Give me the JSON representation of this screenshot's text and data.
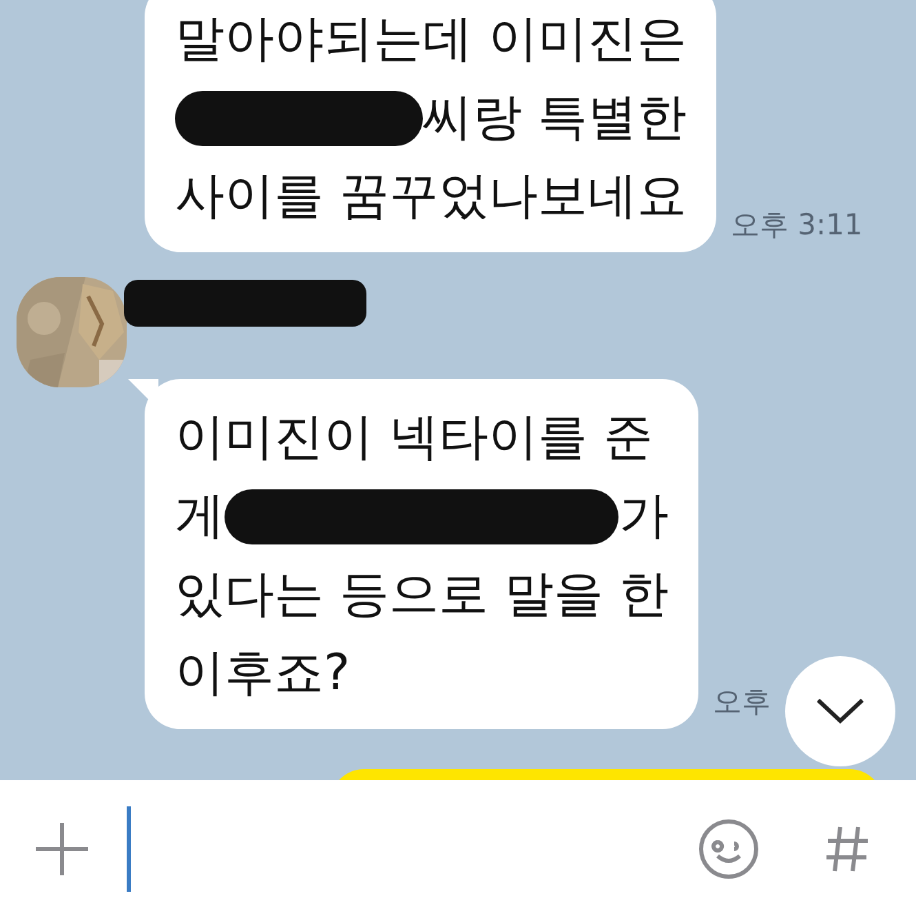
{
  "messages": [
    {
      "kind": "incoming",
      "lines": [
        [
          {
            "kind": "text",
            "text": "말아야되는데 이미진은"
          }
        ],
        [
          {
            "kind": "redacted"
          },
          {
            "kind": "text",
            "text": "씨랑 특별한"
          }
        ],
        [
          {
            "kind": "text",
            "text": "사이를 꿈꾸었나보네요"
          }
        ]
      ],
      "time": "오후 3:11"
    },
    {
      "kind": "incoming",
      "sender": {
        "name": {
          "kind": "redacted"
        }
      },
      "lines": [
        [
          {
            "kind": "text",
            "text": "이미진이 넥타이를 준"
          }
        ],
        [
          {
            "kind": "text",
            "text": "게"
          },
          {
            "kind": "redacted"
          },
          {
            "kind": "text",
            "text": "가"
          }
        ],
        [
          {
            "kind": "text",
            "text": "있다는 등으로 말을 한"
          }
        ],
        [
          {
            "kind": "text",
            "text": "이후죠?"
          }
        ]
      ],
      "time": "오후"
    },
    {
      "kind": "outgoing"
    }
  ],
  "input_bar": {
    "focused": true
  }
}
